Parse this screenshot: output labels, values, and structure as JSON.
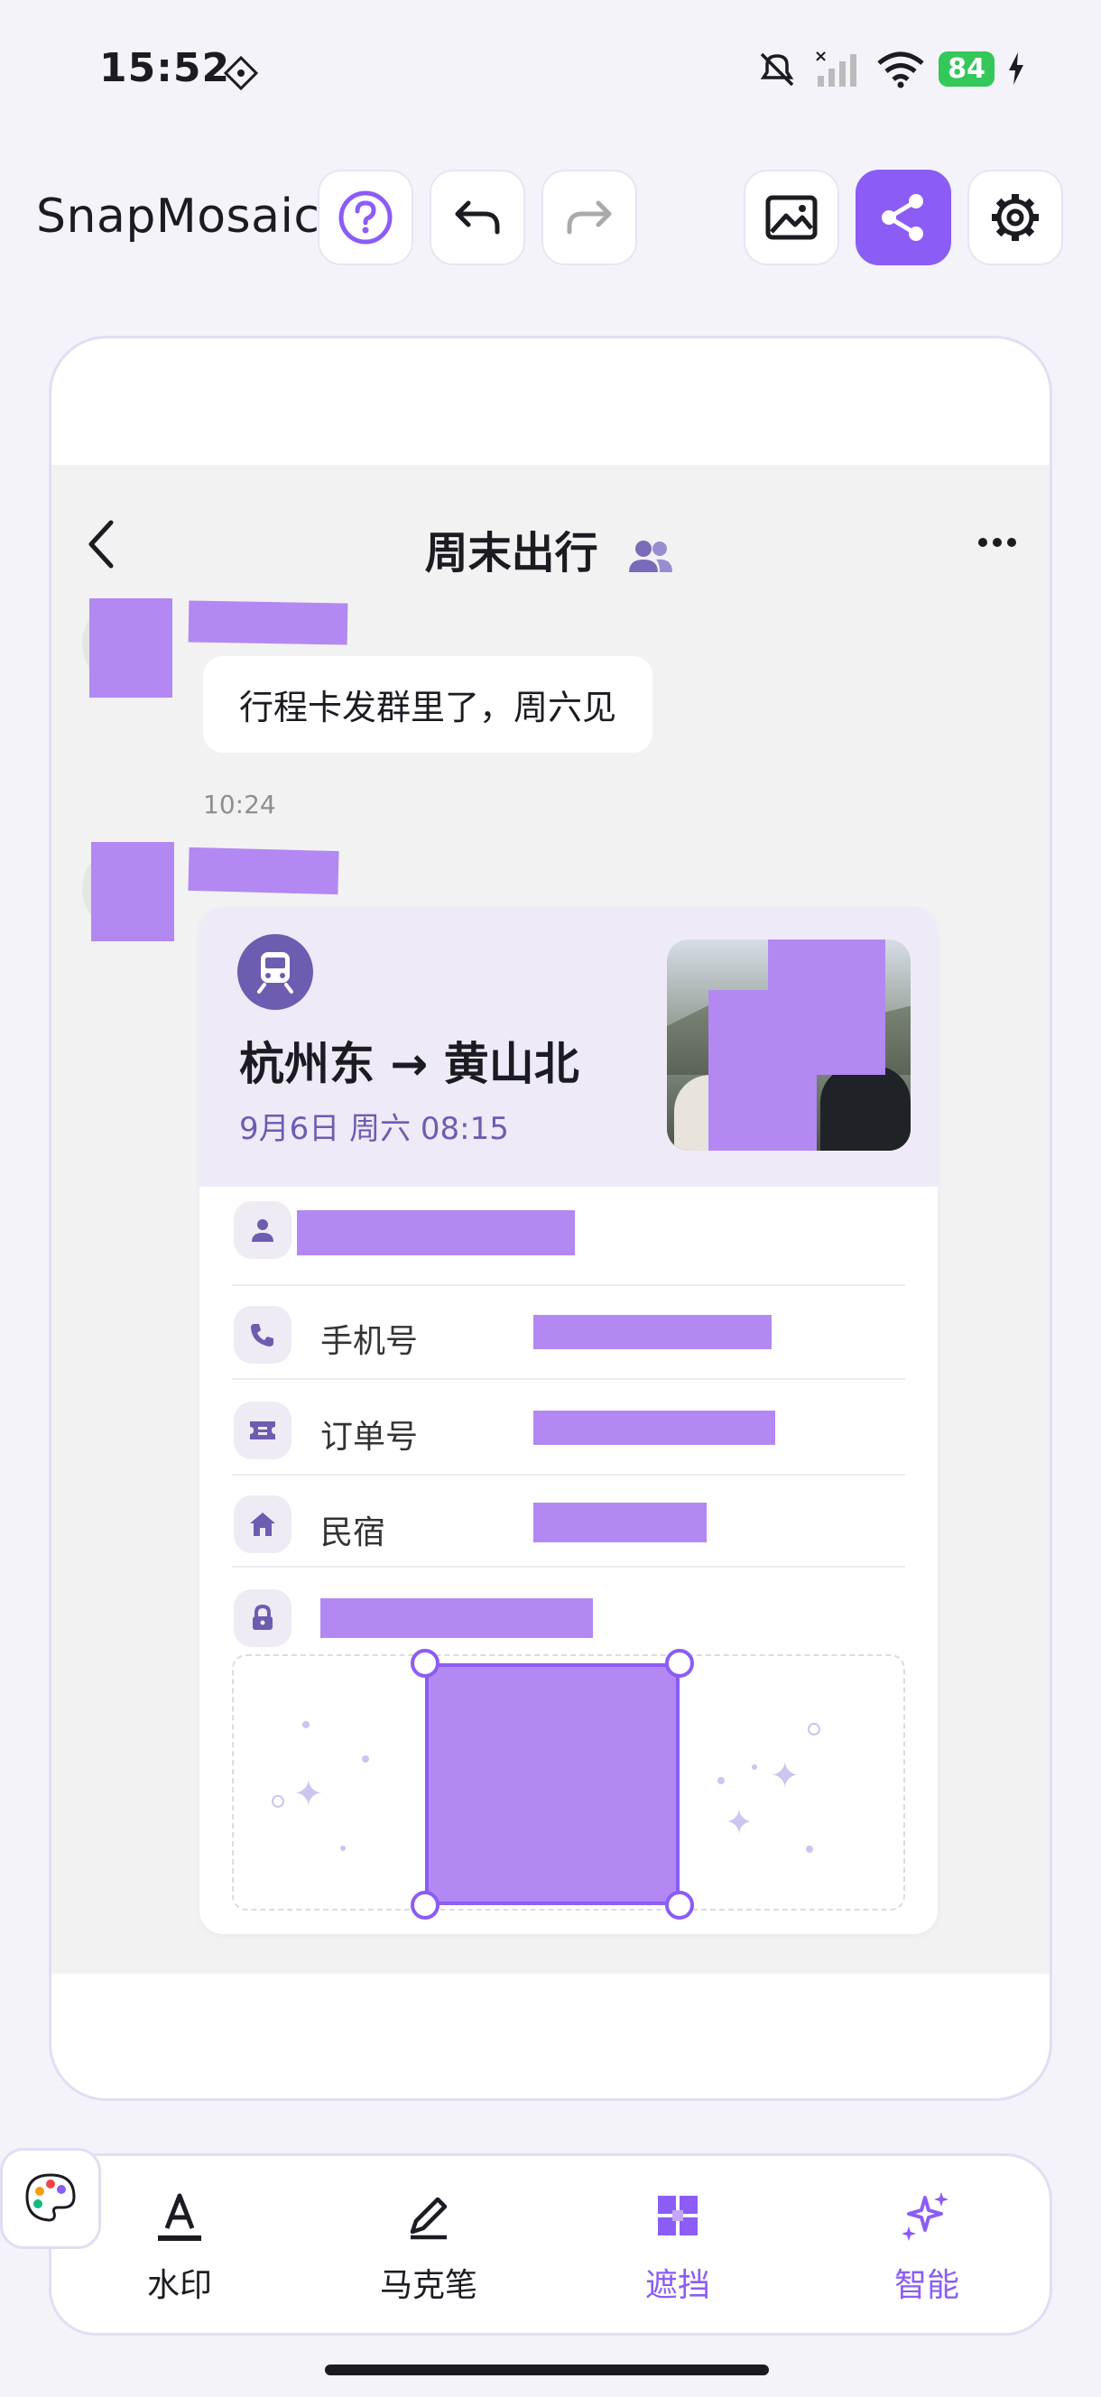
{
  "status_bar": {
    "time": "15:52",
    "battery": "84"
  },
  "header": {
    "app_title": "SnapMosaic"
  },
  "chat": {
    "title": "周末出行",
    "message": "行程卡发群里了，周六见",
    "message_time": "10:24"
  },
  "trip_card": {
    "route": "杭州东 → 黄山北",
    "date": "9月6日 周六 08:15",
    "rows": [
      {
        "icon": "person-icon",
        "label": ""
      },
      {
        "icon": "phone-icon",
        "label": "手机号"
      },
      {
        "icon": "ticket-icon",
        "label": "订单号"
      },
      {
        "icon": "home-icon",
        "label": "民宿"
      },
      {
        "icon": "lock-icon",
        "label": ""
      }
    ]
  },
  "toolbar": {
    "tools": [
      {
        "icon": "text-watermark-icon",
        "label": "水印",
        "active": false
      },
      {
        "icon": "marker-pen-icon",
        "label": "马克笔",
        "active": false
      },
      {
        "icon": "mosaic-block-icon",
        "label": "遮挡",
        "active": true
      },
      {
        "icon": "sparkle-ai-icon",
        "label": "智能",
        "active": true
      }
    ]
  },
  "colors": {
    "accent": "#8b5cf6",
    "redaction": "#b388f2",
    "battery": "#34c759"
  }
}
